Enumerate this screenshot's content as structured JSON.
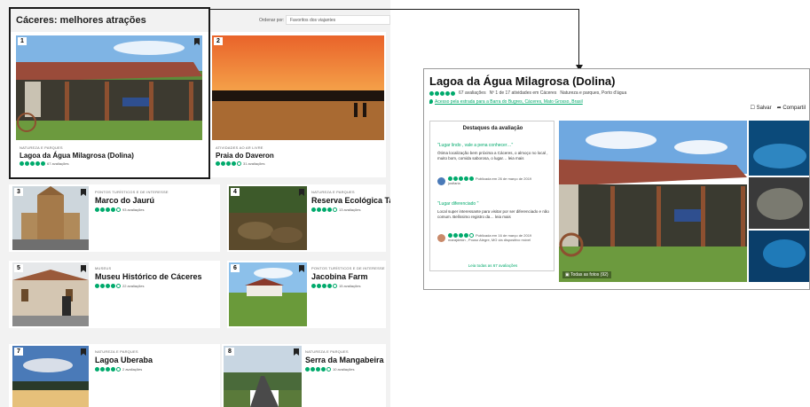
{
  "list": {
    "title": "Cáceres: melhores atrações",
    "sort_label": "Ordenar por:",
    "sort_value": "Favoritos dos viajantes",
    "items": [
      {
        "rank": "1",
        "category": "NATUREZA E PARQUES",
        "name": "Lagoa da Água Milagrosa (Dolina)",
        "reviews": "67 avaliações",
        "rating": 5
      },
      {
        "rank": "2",
        "category": "ATIVIDADES AO AR LIVRE",
        "name": "Praia do Daveron",
        "reviews": "31 avaliações",
        "rating": 4
      },
      {
        "rank": "3",
        "category": "PONTOS TURÍSTICOS E DE INTERESSE",
        "name": "Marco do Jaurú",
        "reviews": "93 avaliações",
        "rating": 4
      },
      {
        "rank": "4",
        "category": "NATUREZA E PARQUES",
        "name": "Reserva Ecológica Taimã",
        "reviews": "13 avaliações",
        "rating": 4
      },
      {
        "rank": "5",
        "category": "MUSEUS",
        "name": "Museu Histórico de Cáceres",
        "reviews": "22 avaliações",
        "rating": 4
      },
      {
        "rank": "6",
        "category": "PONTOS TURÍSTICOS E DE INTERESSE",
        "name": "Jacobina Farm",
        "reviews": "15 avaliações",
        "rating": 4
      },
      {
        "rank": "7",
        "category": "NATUREZA E PARQUES",
        "name": "Lagoa Uberaba",
        "reviews": "2 avaliações",
        "rating": 4
      },
      {
        "rank": "8",
        "category": "NATUREZA E PARQUES",
        "name": "Serra da Mangabeira",
        "reviews": "10 avaliações",
        "rating": 4
      }
    ]
  },
  "detail": {
    "title": "Lagoa da Água Milagrosa (Dolina)",
    "reviews": "67 avaliações",
    "rank_text": "Nº 1 de 17 atividades em Cáceres",
    "categories": "Natureza e parques, Porto d'água",
    "address": "Acesso pela estrada para a Barra do Bugres, Cáceres, Mato Grosso, Brasil",
    "save_label": "Salvar",
    "share_label": "Compartil",
    "highlights_title": "Destaques da avaliação",
    "review1_title": "\"Lugar lindo , vale a pena conhecer…\"",
    "review1_text": "Ótima localização bem próxima a Cáceres, o almoço no local , muito bom, comida saborosa, o lugar… leia mais",
    "review1_date": "Publicada em 26 de março de 2019",
    "review1_user": "jusfiaria",
    "review2_title": "\"Lugar diferenciado \"",
    "review2_text": "Local super interessante para visitar por ser diferenciado e não comum. Belíssimo registro da… leia mais",
    "review2_date": "Publicada em 16 de março de 2019",
    "review2_user": "marajdekin , Pouso Alegre, MG",
    "review2_device": "via dispositivo móvel",
    "read_all": "Leia todas as 67 avaliações",
    "all_photos": "Todas as fotos (92)"
  },
  "colors": {
    "accent": "#00aa6c",
    "frame": "#1a1a1a"
  }
}
